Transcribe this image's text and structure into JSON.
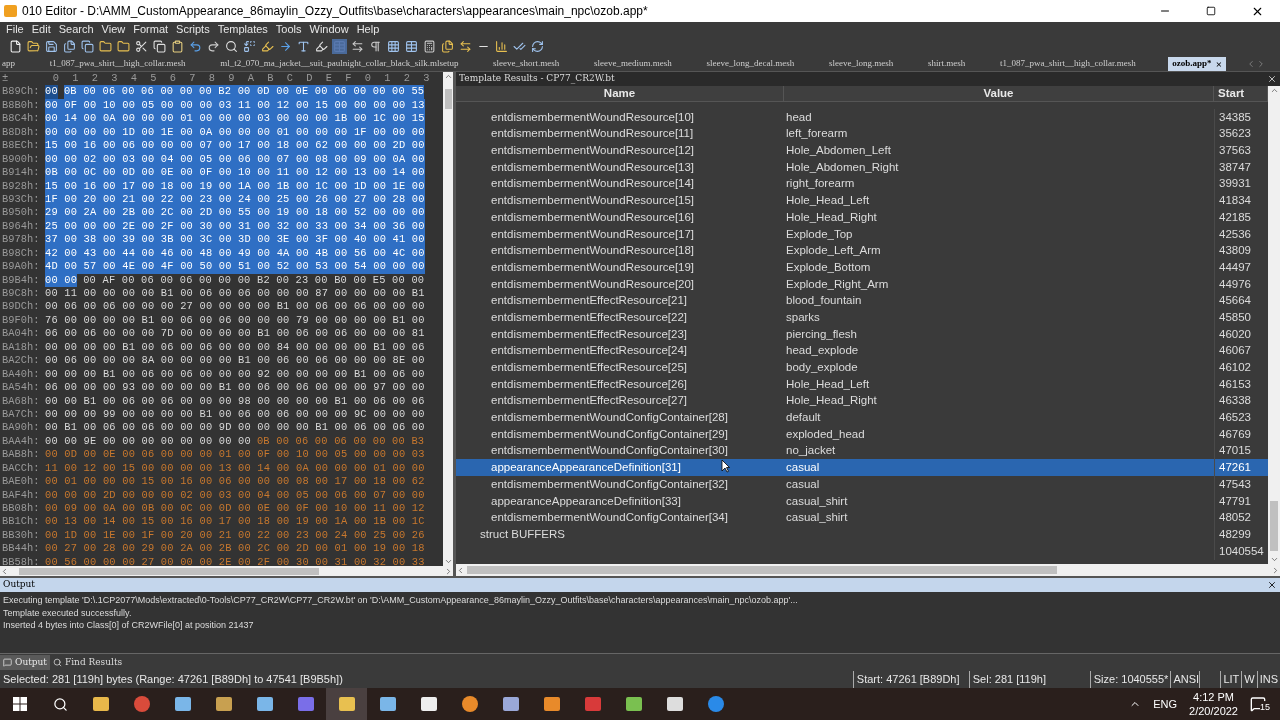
{
  "window": {
    "title": "010 Editor - D:\\AMM_CustomAppearance_86maylin_Ozzy_Outfits\\base\\characters\\appearances\\main_npc\\ozob.app*"
  },
  "menu": [
    "File",
    "Edit",
    "Search",
    "View",
    "Format",
    "Scripts",
    "Templates",
    "Tools",
    "Window",
    "Help"
  ],
  "file_tabs": [
    {
      "label": "app",
      "selected": false
    },
    {
      "label": "t1_087_pwa_shirt__high_collar.mesh",
      "selected": false
    },
    {
      "label": "ml_t2_070_ma_jacket__suit_paulnight_collar_black_silk.mlsetup",
      "selected": false
    },
    {
      "label": "sleeve_short.mesh",
      "selected": false
    },
    {
      "label": "sleeve_medium.mesh",
      "selected": false
    },
    {
      "label": "sleeve_long_decal.mesh",
      "selected": false
    },
    {
      "label": "sleeve_long.mesh",
      "selected": false
    },
    {
      "label": "shirt.mesh",
      "selected": false
    },
    {
      "label": "t1_087_pwa_shirt__high_collar.mesh",
      "selected": false
    },
    {
      "label": "ozob.app*",
      "selected": true,
      "close": "×"
    }
  ],
  "hex": {
    "corner": "±",
    "columns": [
      "0",
      "1",
      "2",
      "3",
      "4",
      "5",
      "6",
      "7",
      "8",
      "9",
      "A",
      "B",
      "C",
      "D",
      "E",
      "F",
      "0",
      "1",
      "2",
      "3"
    ],
    "rows": [
      {
        "offset": "B89Ch:",
        "segments": [
          {
            "kind": "cursor",
            "text": "00"
          },
          {
            "kind": "selected",
            "text": "0B 00 06 00 06 00 00 00 B2 00 0D 00 0E 00 06 00 00 00 55"
          }
        ]
      },
      {
        "offset": "B8B0h:",
        "segments": [
          {
            "kind": "selected",
            "text": "00 0F 00 10 00 05 00 00 00 03 11 00 12 00 15 00 00 00 00 13"
          }
        ]
      },
      {
        "offset": "B8C4h:",
        "segments": [
          {
            "kind": "selected",
            "text": "00 14 00 0A 00 00 00 01 00 00 00 03 00 00 00 1B 00 1C 00 15"
          }
        ]
      },
      {
        "offset": "B8D8h:",
        "segments": [
          {
            "kind": "selected",
            "text": "00 00 00 00 1D 00 1E 00 0A 00 00 00 01 00 00 00 1F 00 00 00"
          }
        ]
      },
      {
        "offset": "B8ECh:",
        "segments": [
          {
            "kind": "selected",
            "text": "15 00 16 00 06 00 00 00 07 00 17 00 18 00 62 00 00 00 2D 00"
          }
        ]
      },
      {
        "offset": "B900h:",
        "segments": [
          {
            "kind": "selected",
            "text": "00 00 02 00 03 00 04 00 05 00 06 00 07 00 08 00 09 00 0A 00"
          }
        ]
      },
      {
        "offset": "B914h:",
        "segments": [
          {
            "kind": "selected",
            "text": "0B 00 0C 00 0D 00 0E 00 0F 00 10 00 11 00 12 00 13 00 14 00"
          }
        ]
      },
      {
        "offset": "B928h:",
        "segments": [
          {
            "kind": "selected",
            "text": "15 00 16 00 17 00 18 00 19 00 1A 00 1B 00 1C 00 1D 00 1E 00"
          }
        ]
      },
      {
        "offset": "B93Ch:",
        "segments": [
          {
            "kind": "selected",
            "text": "1F 00 20 00 21 00 22 00 23 00 24 00 25 00 26 00 27 00 28 00"
          }
        ]
      },
      {
        "offset": "B950h:",
        "segments": [
          {
            "kind": "selected",
            "text": "29 00 2A 00 2B 00 2C 00 2D 00 55 00 19 00 18 00 52 00 00 00"
          }
        ]
      },
      {
        "offset": "B964h:",
        "segments": [
          {
            "kind": "selected",
            "text": "25 00 00 00 2E 00 2F 00 30 00 31 00 32 00 33 00 34 00 36 00"
          }
        ]
      },
      {
        "offset": "B978h:",
        "segments": [
          {
            "kind": "selected",
            "text": "37 00 38 00 39 00 3B 00 3C 00 3D 00 3E 00 3F 00 40 00 41 00"
          }
        ]
      },
      {
        "offset": "B98Ch:",
        "segments": [
          {
            "kind": "selected",
            "text": "42 00 43 00 44 00 46 00 48 00 49 00 4A 00 4B 00 56 00 4C 00"
          }
        ]
      },
      {
        "offset": "B9A0h:",
        "segments": [
          {
            "kind": "selected",
            "text": "4D 00 57 00 4E 00 4F 00 50 00 51 00 52 00 53 00 54 00 00 00"
          }
        ]
      },
      {
        "offset": "B9B4h:",
        "segments": [
          {
            "kind": "selected",
            "text": "00 00"
          },
          {
            "kind": "plain",
            "text": "00 AF 00 06 00 06 00 00 00 B2 00 23 00 B0 00 E5 00 00"
          }
        ]
      },
      {
        "offset": "B9C8h:",
        "segments": [
          {
            "kind": "plain",
            "text": "00 11 00 00 00 00 B1 00 06 00 06 00 00 00 87 00 00 00 00 B1"
          }
        ]
      },
      {
        "offset": "B9DCh:",
        "segments": [
          {
            "kind": "plain",
            "text": "00 06 00 06 00 00 00 27 00 00 00 00 B1 00 06 00 06 00 00 00"
          }
        ]
      },
      {
        "offset": "B9F0h:",
        "segments": [
          {
            "kind": "plain",
            "text": "76 00 00 00 00 B1 00 06 00 06 00 00 00 79 00 00 00 00 B1 00"
          }
        ]
      },
      {
        "offset": "BA04h:",
        "segments": [
          {
            "kind": "plain",
            "text": "06 00 06 00 00 00 7D 00 00 00 00 B1 00 06 00 06 00 00 00 81"
          }
        ]
      },
      {
        "offset": "BA18h:",
        "segments": [
          {
            "kind": "plain",
            "text": "00 00 00 00 B1 00 06 00 06 00 00 00 84 00 00 00 00 B1 00 06"
          }
        ]
      },
      {
        "offset": "BA2Ch:",
        "segments": [
          {
            "kind": "plain",
            "text": "00 06 00 00 00 8A 00 00 00 00 B1 00 06 00 06 00 00 00 8E 00"
          }
        ]
      },
      {
        "offset": "BA40h:",
        "segments": [
          {
            "kind": "plain",
            "text": "00 00 00 B1 00 06 00 06 00 00 00 92 00 00 00 00 B1 00 06 00"
          }
        ]
      },
      {
        "offset": "BA54h:",
        "segments": [
          {
            "kind": "plain",
            "text": "06 00 00 00 93 00 00 00 00 B1 00 06 00 06 00 00 00 97 00 00"
          }
        ]
      },
      {
        "offset": "BA68h:",
        "segments": [
          {
            "kind": "plain",
            "text": "00 00 B1 00 06 00 06 00 00 00 98 00 00 00 00 B1 00 06 00 06"
          }
        ]
      },
      {
        "offset": "BA7Ch:",
        "segments": [
          {
            "kind": "plain",
            "text": "00 00 00 99 00 00 00 00 B1 00 06 00 06 00 00 00 9C 00 00 00"
          }
        ]
      },
      {
        "offset": "BA90h:",
        "segments": [
          {
            "kind": "plain",
            "text": "00 B1 00 06 00 06 00 00 00 9D 00 00 00 00 B1 00 06 00 06 00"
          }
        ]
      },
      {
        "offset": "BAA4h:",
        "segments": [
          {
            "kind": "plain",
            "text": "00 00 9E 00 00 00 00 00 00 00 00"
          },
          {
            "kind": "template",
            "text": "0B 00 06 00 06 00 00 00 B3"
          }
        ]
      },
      {
        "offset": "BAB8h:",
        "segments": [
          {
            "kind": "template",
            "text": "00 0D 00 0E 00 06 00 00 00 01 00 0F 00 10 00 05 00 00 00 03"
          }
        ]
      },
      {
        "offset": "BACCh:",
        "segments": [
          {
            "kind": "template",
            "text": "11 00 12 00 15 00 00 00 00 13 00 14 00 0A 00 00 00 01 00 00"
          }
        ]
      },
      {
        "offset": "BAE0h:",
        "segments": [
          {
            "kind": "template",
            "text": "00 01 00 00 00 15 00 16 00 06 00 00 00 08 00 17 00 18 00 62"
          }
        ]
      },
      {
        "offset": "BAF4h:",
        "segments": [
          {
            "kind": "template",
            "text": "00 00 00 2D 00 00 00 02 00 03 00 04 00 05 00 06 00 07 00 00"
          }
        ]
      },
      {
        "offset": "BB08h:",
        "segments": [
          {
            "kind": "template",
            "text": "00 09 00 0A 00 0B 00 0C 00 0D 00 0E 00 0F 00 10 00 11 00 12"
          }
        ]
      },
      {
        "offset": "BB1Ch:",
        "segments": [
          {
            "kind": "template",
            "text": "00 13 00 14 00 15 00 16 00 17 00 18 00 19 00 1A 00 1B 00 1C"
          }
        ]
      },
      {
        "offset": "BB30h:",
        "segments": [
          {
            "kind": "template",
            "text": "00 1D 00 1E 00 1F 00 20 00 21 00 22 00 23 00 24 00 25 00 26"
          }
        ]
      },
      {
        "offset": "BB44h:",
        "segments": [
          {
            "kind": "template",
            "text": "00 27 00 28 00 29 00 2A 00 2B 00 2C 00 2D 00 01 00 19 00 18"
          }
        ]
      },
      {
        "offset": "BB58h:",
        "segments": [
          {
            "kind": "template",
            "text": "00 56 00 00 00 27 00 00 00 2E 00 2F 00 30 00 31 00 32 00 33"
          }
        ]
      }
    ]
  },
  "template_results": {
    "title": "Template Results - CP77_CR2W.bt",
    "columns": [
      "Name",
      "Value",
      "Start"
    ],
    "rows": [
      {
        "kind": "entry",
        "name": "entdismembermentWoundResource[10]",
        "value": "head",
        "start": "34385",
        "selected": false
      },
      {
        "kind": "entry",
        "name": "entdismembermentWoundResource[11]",
        "value": "left_forearm",
        "start": "35623",
        "selected": false
      },
      {
        "kind": "entry",
        "name": "entdismembermentWoundResource[12]",
        "value": "Hole_Abdomen_Left",
        "start": "37563",
        "selected": false
      },
      {
        "kind": "entry",
        "name": "entdismembermentWoundResource[13]",
        "value": "Hole_Abdomen_Right",
        "start": "38747",
        "selected": false
      },
      {
        "kind": "entry",
        "name": "entdismembermentWoundResource[14]",
        "value": "right_forearm",
        "start": "39931",
        "selected": false
      },
      {
        "kind": "entry",
        "name": "entdismembermentWoundResource[15]",
        "value": "Hole_Head_Left",
        "start": "41834",
        "selected": false
      },
      {
        "kind": "entry",
        "name": "entdismembermentWoundResource[16]",
        "value": "Hole_Head_Right",
        "start": "42185",
        "selected": false
      },
      {
        "kind": "entry",
        "name": "entdismembermentWoundResource[17]",
        "value": "Explode_Top",
        "start": "42536",
        "selected": false
      },
      {
        "kind": "entry",
        "name": "entdismembermentWoundResource[18]",
        "value": "Explode_Left_Arm",
        "start": "43809",
        "selected": false
      },
      {
        "kind": "entry",
        "name": "entdismembermentWoundResource[19]",
        "value": "Explode_Bottom",
        "start": "44497",
        "selected": false
      },
      {
        "kind": "entry",
        "name": "entdismembermentWoundResource[20]",
        "value": "Explode_Right_Arm",
        "start": "44976",
        "selected": false
      },
      {
        "kind": "entry",
        "name": "entdismembermentEffectResource[21]",
        "value": "blood_fountain",
        "start": "45664",
        "selected": false
      },
      {
        "kind": "entry",
        "name": "entdismembermentEffectResource[22]",
        "value": "sparks",
        "start": "45850",
        "selected": false
      },
      {
        "kind": "entry",
        "name": "entdismembermentEffectResource[23]",
        "value": "piercing_flesh",
        "start": "46020",
        "selected": false
      },
      {
        "kind": "entry",
        "name": "entdismembermentEffectResource[24]",
        "value": "head_explode",
        "start": "46067",
        "selected": false
      },
      {
        "kind": "entry",
        "name": "entdismembermentEffectResource[25]",
        "value": "body_explode",
        "start": "46102",
        "selected": false
      },
      {
        "kind": "entry",
        "name": "entdismembermentEffectResource[26]",
        "value": "Hole_Head_Left",
        "start": "46153",
        "selected": false
      },
      {
        "kind": "entry",
        "name": "entdismembermentEffectResource[27]",
        "value": "Hole_Head_Right",
        "start": "46338",
        "selected": false
      },
      {
        "kind": "entry",
        "name": "entdismembermentWoundConfigContainer[28]",
        "value": "default",
        "start": "46523",
        "selected": false
      },
      {
        "kind": "entry",
        "name": "entdismembermentWoundConfigContainer[29]",
        "value": "exploded_head",
        "start": "46769",
        "selected": false
      },
      {
        "kind": "entry",
        "name": "entdismembermentWoundConfigContainer[30]",
        "value": "no_jacket",
        "start": "47015",
        "selected": false
      },
      {
        "kind": "entry",
        "name": "appearanceAppearanceDefinition[31]",
        "value": "casual",
        "start": "47261",
        "selected": true
      },
      {
        "kind": "entry",
        "name": "entdismembermentWoundConfigContainer[32]",
        "value": "casual",
        "start": "47543",
        "selected": false
      },
      {
        "kind": "entry",
        "name": "appearanceAppearanceDefinition[33]",
        "value": "casual_shirt",
        "start": "47791",
        "selected": false
      },
      {
        "kind": "entry",
        "name": "entdismembermentWoundConfigContainer[34]",
        "value": "casual_shirt",
        "start": "48052",
        "selected": false
      },
      {
        "kind": "struct",
        "name": "struct BUFFERS",
        "start": "48299",
        "selected": false
      },
      {
        "kind": "total",
        "start": "1040554",
        "selected": false
      }
    ]
  },
  "output": {
    "title": "Output",
    "lines": [
      "Executing template 'D:\\.1CP2077\\Mods\\extracted\\0-Tools\\CP77_CR2W\\CP77_CR2W.bt' on 'D:\\AMM_CustomAppearance_86maylin_Ozzy_Outfits\\base\\characters\\appearances\\main_npc\\ozob.app'...",
      "Template executed successfully.",
      "Inserted 4 bytes into Class[0] of CR2WFile[0] at position 21437"
    ],
    "tabs": [
      {
        "label": "Output",
        "selected": true
      },
      {
        "label": "Find Results",
        "selected": false
      }
    ]
  },
  "status_bar": {
    "selection": "Selected: 281 [119h] bytes (Range: 47261 [B89Dh] to 47541 [B9B5h])",
    "start": "Start: 47261 [B89Dh]",
    "sel": "Sel: 281 [119h]",
    "size": "Size: 1040555*",
    "encoding": "ANSI",
    "flags": [
      "LIT",
      "W",
      "INS"
    ]
  },
  "taskbar": {
    "language": "ENG",
    "time": "4:12 PM",
    "date": "2/20/2022",
    "notifications": "15"
  }
}
